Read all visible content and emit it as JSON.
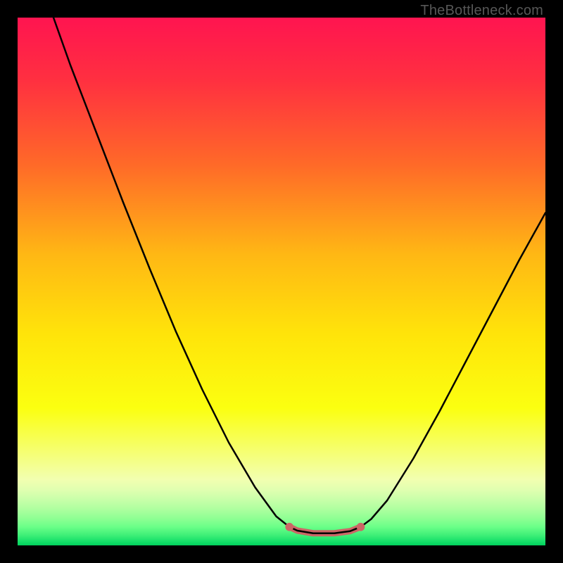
{
  "attribution": "TheBottleneck.com",
  "chart_data": {
    "type": "line",
    "title": "",
    "xlabel": "",
    "ylabel": "",
    "xlim": [
      0,
      100
    ],
    "ylim": [
      0,
      100
    ],
    "grid": false,
    "gradient_stops": [
      {
        "offset": 0.0,
        "color": "#ff1450"
      },
      {
        "offset": 0.12,
        "color": "#ff3040"
      },
      {
        "offset": 0.28,
        "color": "#ff6a28"
      },
      {
        "offset": 0.45,
        "color": "#ffb814"
      },
      {
        "offset": 0.6,
        "color": "#ffe40a"
      },
      {
        "offset": 0.74,
        "color": "#fbff10"
      },
      {
        "offset": 0.875,
        "color": "#f2ffb0"
      },
      {
        "offset": 0.895,
        "color": "#e0ffb0"
      },
      {
        "offset": 0.912,
        "color": "#caffaa"
      },
      {
        "offset": 0.93,
        "color": "#b0ffa0"
      },
      {
        "offset": 0.948,
        "color": "#90ff94"
      },
      {
        "offset": 0.965,
        "color": "#6aff88"
      },
      {
        "offset": 0.98,
        "color": "#40f078"
      },
      {
        "offset": 0.992,
        "color": "#18e06a"
      },
      {
        "offset": 1.0,
        "color": "#00d05c"
      }
    ],
    "curve_points": [
      {
        "x": 6.8,
        "y": 100.0
      },
      {
        "x": 10.0,
        "y": 91.0
      },
      {
        "x": 15.0,
        "y": 78.0
      },
      {
        "x": 20.0,
        "y": 65.0
      },
      {
        "x": 25.0,
        "y": 52.5
      },
      {
        "x": 30.0,
        "y": 40.5
      },
      {
        "x": 35.0,
        "y": 29.5
      },
      {
        "x": 40.0,
        "y": 19.5
      },
      {
        "x": 45.0,
        "y": 11.0
      },
      {
        "x": 49.0,
        "y": 5.5
      },
      {
        "x": 51.5,
        "y": 3.5
      },
      {
        "x": 53.0,
        "y": 2.8
      },
      {
        "x": 56.0,
        "y": 2.3
      },
      {
        "x": 60.0,
        "y": 2.3
      },
      {
        "x": 63.0,
        "y": 2.7
      },
      {
        "x": 65.0,
        "y": 3.5
      },
      {
        "x": 67.0,
        "y": 5.0
      },
      {
        "x": 70.0,
        "y": 8.5
      },
      {
        "x": 75.0,
        "y": 16.5
      },
      {
        "x": 80.0,
        "y": 25.5
      },
      {
        "x": 85.0,
        "y": 35.0
      },
      {
        "x": 90.0,
        "y": 44.5
      },
      {
        "x": 95.0,
        "y": 54.0
      },
      {
        "x": 100.0,
        "y": 63.0
      }
    ],
    "highlight_range": {
      "x_start": 51.5,
      "x_end": 65.0
    },
    "highlight_color": "#cc6666",
    "highlight_stroke_width": 9,
    "curve_stroke_width": 2.5,
    "curve_color": "#000000"
  }
}
